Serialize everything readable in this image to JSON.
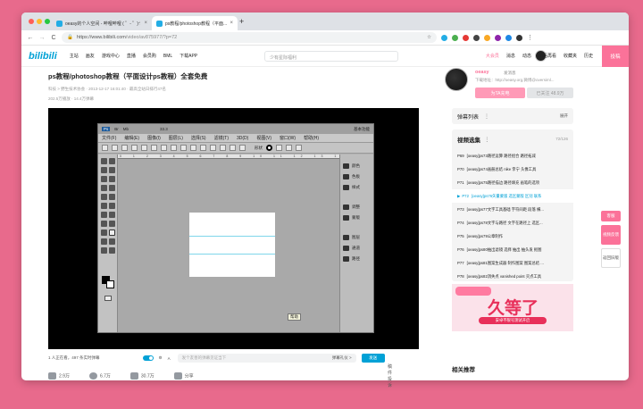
{
  "browser": {
    "tabs": [
      {
        "label": "oeasy的个人空间 - 哔哩哔哩 ( ゜- ゜)つロ"
      },
      {
        "label": "ps教程/photoshop教程（平面..."
      }
    ],
    "url_host": "https://www.bilibili.com",
    "url_path": "/video/av875977/?p=72",
    "nav": {
      "back": "←",
      "forward": "→",
      "reload": "C",
      "new_tab": "+"
    }
  },
  "site_header": {
    "logo": "bilibili",
    "nav": [
      "主站",
      "画友",
      "游戏中心",
      "直播",
      "会员购",
      "BML",
      "下载APP"
    ],
    "search_placeholder": "少有星际福利",
    "right": [
      "大会员",
      "消息",
      "动态",
      "稍后再看",
      "收藏夹",
      "历史"
    ],
    "upload_label": "投稿"
  },
  "video": {
    "title": "ps教程/photoshop教程（平面设计ps教程）全套免费",
    "meta_line1": "科技 > 野生技术协会 · 2013-12-17 16:01:40 · 最高全站日排行47名",
    "meta_line2": "202.5万播放 · 14.4万弹幕"
  },
  "photoshop": {
    "top": [
      "Ps",
      "Br",
      "Mb",
      "33.3",
      "基本功能"
    ],
    "menu": [
      "文件(F)",
      "编辑(E)",
      "图像(I)",
      "图层(L)",
      "选择(S)",
      "滤镜(T)",
      "3D(D)",
      "视图(V)",
      "窗口(W)",
      "帮助(H)"
    ],
    "options_label": "形状",
    "ruler_text": "0  1  2  3  4  5  6  7  8  9 10 11 12 13 14 15",
    "panels": [
      "颜色",
      "色板",
      "样式",
      "调整",
      "蒙版",
      "图层",
      "通道",
      "路径"
    ],
    "tooltip": "帮助"
  },
  "danmaku_bar": {
    "watching": "1 人正在看，",
    "count": "497 条实时弹幕",
    "input_placeholder": "发个友善的弹幕见证当下",
    "etiquette": "弹幕礼仪 >",
    "send": "发送"
  },
  "actions": {
    "like": "2.9万",
    "coin": "6.7万",
    "fav": "30.7万",
    "share": "分享",
    "report": "稿件投诉"
  },
  "uploader": {
    "name": "oeasy",
    "message": "发消息",
    "desc": "下载地址：http://oeasy.org,微博@oversiml...",
    "charge": "为TA充电",
    "follow": "已关注 48.9万"
  },
  "danmaku_list": {
    "title": "弹幕列表",
    "expand": "展开"
  },
  "playlist": {
    "title": "视频选集",
    "count": "72/126",
    "items": [
      {
        "num": "P69",
        "label": "[oeasy]ps73路径运算 路径组合 路径拓减"
      },
      {
        "num": "P70",
        "label": "[oeasy]ps74画册总结 nike 李宁 头像工具"
      },
      {
        "num": "P71",
        "label": "[oeasy]ps75路径描边 路径填充 画笔的选项"
      },
      {
        "num": "P72",
        "label": "[oeasy]ps76矢量蒙版 选区蒙版 区别 联系"
      },
      {
        "num": "P73",
        "label": "[oeasy]ps77文字工具基础 字符间距 段落 横..."
      },
      {
        "num": "P74",
        "label": "[oeasy]ps78文字与路径 文字在路径上 选区..."
      },
      {
        "num": "P75",
        "label": "[oeasy]ps79公章制作"
      },
      {
        "num": "P76",
        "label": "[oeasy]ps80抽出滤镜 选择 抽出 抽头发 抠图"
      },
      {
        "num": "P77",
        "label": "[oeasy]ps81图案生成器 制作图案 图案总结 ..."
      },
      {
        "num": "P78",
        "label": "[oeasy]ps82消失点 vanished point 灭点工具"
      }
    ]
  },
  "ad": {
    "title": "久等了",
    "sub": "安卓不限号测试开启"
  },
  "recommend": "相关推荐",
  "float_buttons": [
    "客服",
    "视频反馈",
    "返回旧版"
  ],
  "colors": {
    "accent": "#00a1d6",
    "pink": "#fb7299",
    "bg": "#e86a8c"
  }
}
